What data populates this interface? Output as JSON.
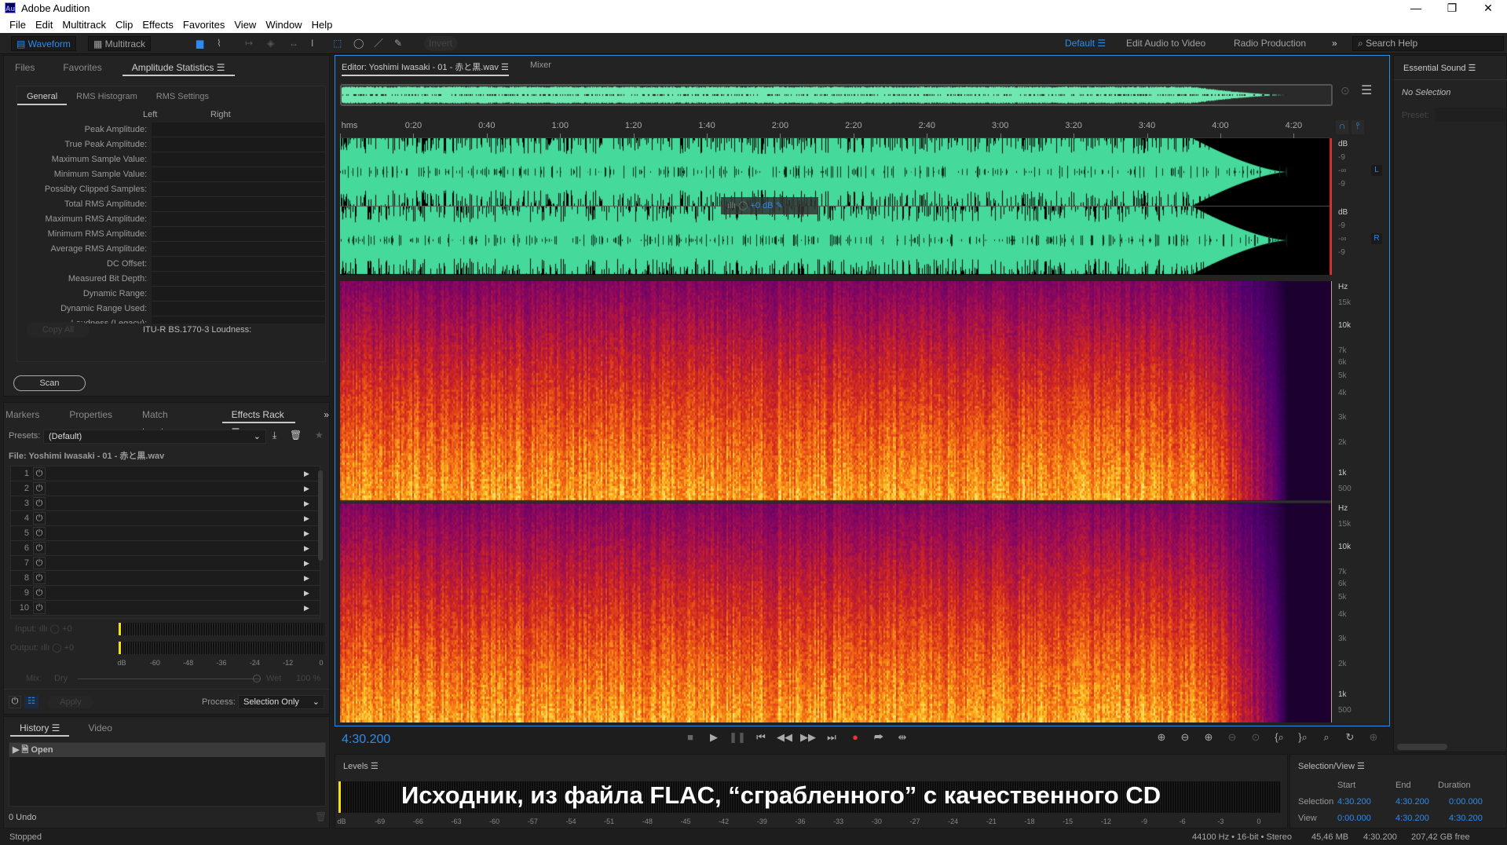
{
  "window": {
    "app_icon": "Au",
    "title": "Adobe Audition",
    "minimize": "—",
    "restore": "❐",
    "close": "✕"
  },
  "menu": [
    "File",
    "Edit",
    "Multitrack",
    "Clip",
    "Effects",
    "Favorites",
    "View",
    "Window",
    "Help"
  ],
  "toolbar": {
    "waveform": "Waveform",
    "multitrack": "Multitrack",
    "invert": "Invert",
    "workspaces": [
      "Default",
      "Edit Audio to Video",
      "Radio Production"
    ],
    "more": "»",
    "search_placeholder": "Search Help"
  },
  "left_top": {
    "tabs": [
      "Files",
      "Favorites",
      "Amplitude Statistics"
    ],
    "subtabs": [
      "General",
      "RMS Histogram",
      "RMS Settings"
    ],
    "columns": [
      "Left",
      "Right"
    ],
    "stats": [
      "Peak Amplitude:",
      "True Peak Amplitude:",
      "Maximum Sample Value:",
      "Minimum Sample Value:",
      "Possibly Clipped Samples:",
      "Total RMS Amplitude:",
      "Maximum RMS Amplitude:",
      "Minimum RMS Amplitude:",
      "Average RMS Amplitude:",
      "DC Offset:",
      "Measured Bit Depth:",
      "Dynamic Range:",
      "Dynamic Range Used:",
      "Loudness (Legacy):"
    ],
    "copy_all": "Copy All",
    "itu": "ITU-R BS.1770-3 Loudness:",
    "scan": "Scan"
  },
  "effects": {
    "tabs": [
      "Markers",
      "Properties",
      "Match Loudness",
      "Effects Rack"
    ],
    "presets_label": "Presets:",
    "preset": "(Default)",
    "file": "File: Yoshimi Iwasaki - 01 - 赤と黒.wav",
    "slots": [
      "1",
      "2",
      "3",
      "4",
      "5",
      "6",
      "7",
      "8",
      "9",
      "10"
    ],
    "input_label": "Input:",
    "output_label": "Output:",
    "input_gain": "+0",
    "output_gain": "+0",
    "meter_ticks": [
      "dB",
      "-60",
      "-48",
      "-36",
      "-24",
      "-12",
      "0"
    ],
    "mix_label": "Mix:",
    "dry": "Dry",
    "wet": "Wet",
    "mix_value": "100 %",
    "mix_fraction": 1.0,
    "apply": "Apply",
    "process_label": "Process:",
    "process": "Selection Only"
  },
  "history": {
    "tabs": [
      "History",
      "Video"
    ],
    "items": [
      "Open"
    ],
    "undo": "0 Undo"
  },
  "status": "Stopped",
  "editor": {
    "tab": "Editor: Yoshimi Iwasaki - 01 - 赤と黒.wav",
    "mixer": "Mixer",
    "ruler": [
      "hms",
      "0:20",
      "0:40",
      "1:00",
      "1:20",
      "1:40",
      "2:00",
      "2:20",
      "2:40",
      "3:00",
      "3:20",
      "3:40",
      "4:00",
      "4:20"
    ],
    "hud_gain": "+0 dB",
    "db_scale": [
      "dB",
      "-9",
      "-∞",
      "-9"
    ],
    "channels": [
      "L",
      "R"
    ],
    "hz_scale": [
      "Hz",
      "15k",
      "10k",
      "7k",
      "6k",
      "5k",
      "4k",
      "3k",
      "2k",
      "1k",
      "500"
    ],
    "time": "4:30.200"
  },
  "essential": {
    "title": "Essential Sound",
    "no_selection": "No Selection",
    "preset": "Preset:"
  },
  "levels": {
    "title": "Levels",
    "overlay": "Исходник, из файла FLAC, “сграбленного” с качественного CD",
    "ticks": [
      "dB",
      "-69",
      "-66",
      "-63",
      "-60",
      "-57",
      "-54",
      "-51",
      "-48",
      "-45",
      "-42",
      "-39",
      "-36",
      "-33",
      "-30",
      "-27",
      "-24",
      "-21",
      "-18",
      "-15",
      "-12",
      "-9",
      "-6",
      "-3",
      "0"
    ]
  },
  "selview": {
    "title": "Selection/View",
    "headers": [
      "Start",
      "End",
      "Duration"
    ],
    "rows": [
      {
        "label": "Selection",
        "start": "4:30.200",
        "end": "4:30.200",
        "duration": "0:00.000"
      },
      {
        "label": "View",
        "start": "0:00.000",
        "end": "4:30.200",
        "duration": "4:30.200"
      }
    ]
  },
  "statusbar": {
    "format": "44100 Hz • 16-bit • Stereo",
    "size": "45,46 MB",
    "duration": "4:30.200",
    "free": "207,42 GB free"
  },
  "colors": {
    "accent": "#2d8ceb",
    "waveform": "#45d99b",
    "record": "#e8333a",
    "meter": "#f5e400"
  }
}
